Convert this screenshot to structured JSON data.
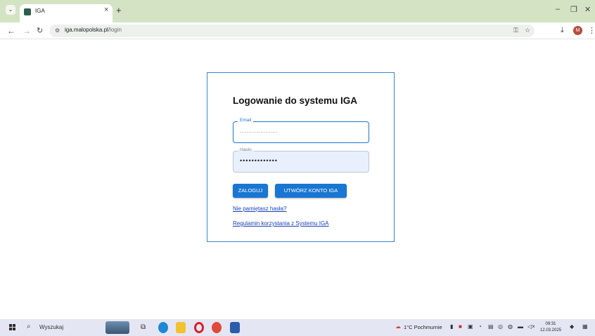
{
  "browser": {
    "tab_title": "IGA",
    "tab_close": "×",
    "new_tab": "+",
    "url_host": "iga.malopolska.pl",
    "url_path": "/login",
    "profile_initial": "M"
  },
  "login": {
    "title": "Logowanie do systemu IGA",
    "email_label": "Email",
    "email_value": "......................",
    "password_label": "Hasło",
    "password_value": "•••••••••••••",
    "login_button": "ZALOGUJ",
    "create_button": "UTWÓRZ KONTO IGA",
    "forgot_link": "Nie pamiętasz hasła?",
    "terms_link": "Regulamin korzystania z Systemu IGA"
  },
  "taskbar": {
    "search_placeholder": "Wyszukaj",
    "weather": "1°C Pochmurnie",
    "time": "09:31",
    "date": "12.03.2025"
  },
  "colors": {
    "tab_strip": "#d3e3c4",
    "primary": "#1976d2",
    "card_border": "#3a84c7",
    "autofill_bg": "#e8f0fe",
    "link": "#1a3fb5"
  }
}
